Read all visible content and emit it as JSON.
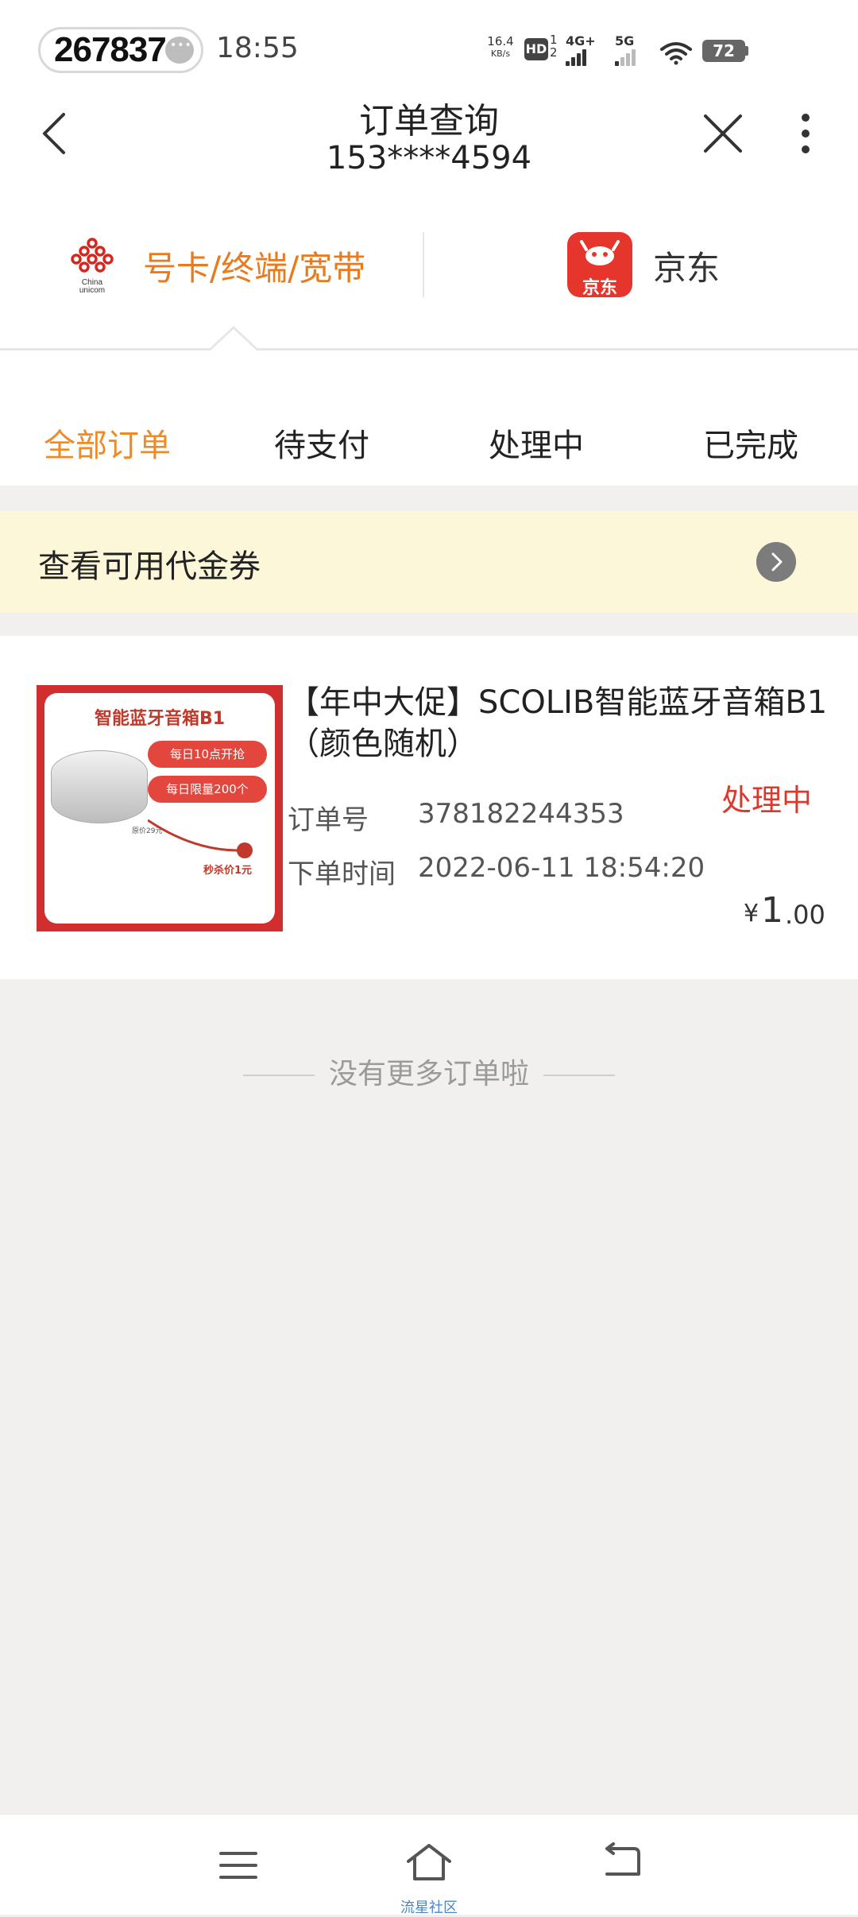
{
  "status_bar": {
    "code": "267837",
    "time": "18:55",
    "net_speed": "16.4",
    "net_speed_unit": "KB/s",
    "hd_badge": "HD",
    "hd_sup": "1 2",
    "sig1_label": "4G+",
    "sig2_label": "5G",
    "battery": "72"
  },
  "header": {
    "title": "订单查询",
    "subtitle": "153****4594"
  },
  "brand_tabs": [
    {
      "label": "号卡/终端/宽带",
      "logo_text": "China unicom",
      "active": true
    },
    {
      "label": "京东",
      "logo_text": "京东",
      "active": false
    }
  ],
  "status_tabs": [
    {
      "label": "全部订单",
      "active": true
    },
    {
      "label": "待支付",
      "active": false
    },
    {
      "label": "处理中",
      "active": false
    },
    {
      "label": "已完成",
      "active": false
    }
  ],
  "coupon": {
    "label": "查看可用代金券"
  },
  "order": {
    "title": "【年中大促】SCOLIB智能蓝牙音箱B1（颜色随机）",
    "status": "处理中",
    "order_no_label": "订单号",
    "order_no": "378182244353",
    "time_label": "下单时间",
    "time": "2022-06-11 18:54:20",
    "price_symbol": "¥",
    "price_int": "1",
    "price_dec": ".00",
    "image_text": {
      "headline": "智能蓝牙音箱B1",
      "tag1": "每日10点开抢",
      "tag2": "每日限量200个",
      "price_note": "秒杀价1元",
      "left_note": "原价29元"
    }
  },
  "end_note": "没有更多订单啦",
  "bottom_nav": {
    "home_label": "流星社区"
  },
  "colors": {
    "accent_orange": "#ef8a25",
    "status_red": "#d93a2b",
    "coupon_bg": "#fdf7d9",
    "jd_red": "#e5352c"
  }
}
